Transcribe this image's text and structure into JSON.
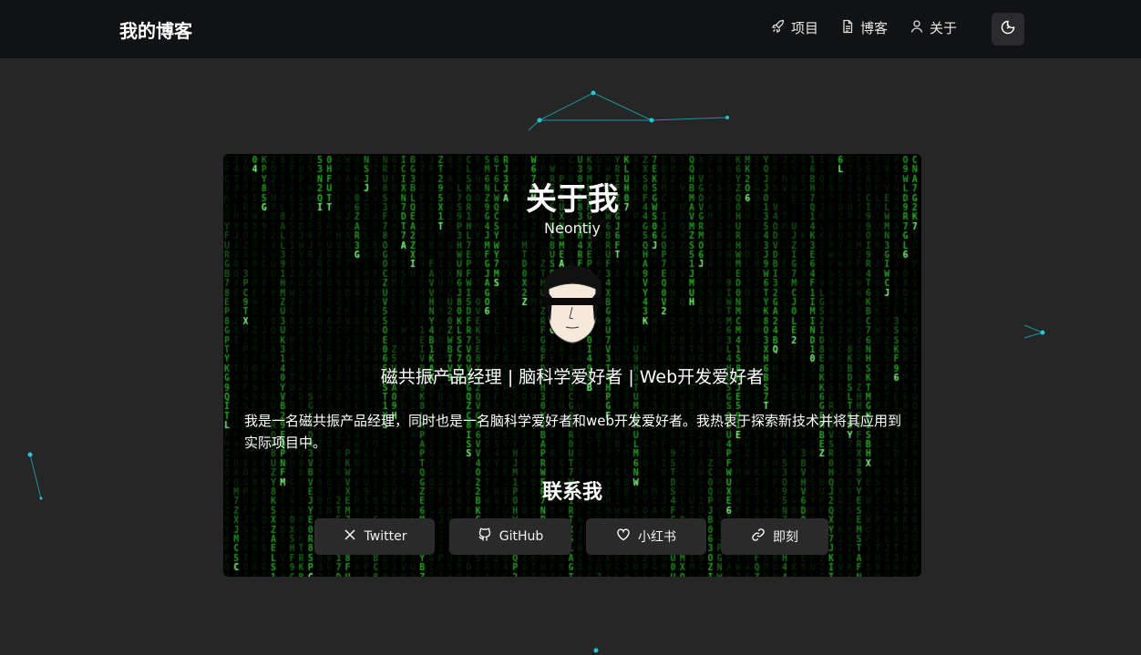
{
  "nav": {
    "brand": "我的博客",
    "links": [
      {
        "label": "项目",
        "icon": "rocket-icon"
      },
      {
        "label": "博客",
        "icon": "document-icon"
      },
      {
        "label": "关于",
        "icon": "user-icon"
      }
    ],
    "theme_toggle_icon": "moon-icon"
  },
  "about": {
    "title": "关于我",
    "name": "Neontiy",
    "tagline": "磁共振产品经理 | 脑科学爱好者 | Web开发爱好者",
    "intro": "我是一名磁共振产品经理，同时也是一名脑科学爱好者和web开发爱好者。我热衷于探索新技术并将其应用到实际项目中。"
  },
  "contact": {
    "title": "联系我",
    "buttons": [
      {
        "label": "Twitter",
        "icon": "x-icon"
      },
      {
        "label": "GitHub",
        "icon": "github-icon"
      },
      {
        "label": "小红书",
        "icon": "heart-icon"
      },
      {
        "label": "即刻",
        "icon": "link-icon"
      }
    ]
  },
  "colors": {
    "page_bg": "#262626",
    "navbar_bg": "#111214",
    "matrix_green": "#22c51e",
    "network_cyan": "#1bb8c8"
  }
}
